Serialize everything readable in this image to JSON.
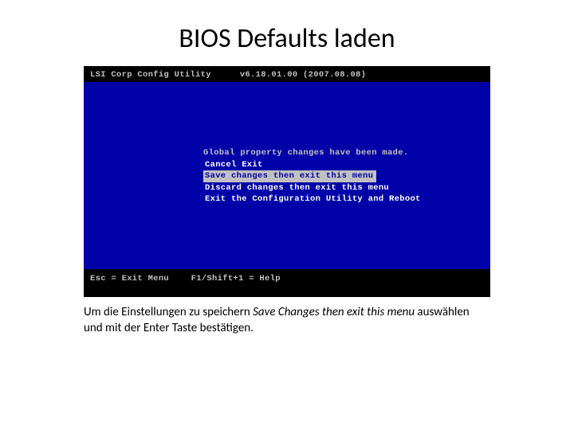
{
  "slide": {
    "title": "BIOS Defaults laden"
  },
  "bios": {
    "headerApp": "LSI Corp Config Utility",
    "headerVersion": "v6.18.01.00 (2007.08.08)",
    "prompt": "Global property changes have been made.",
    "menu": {
      "item0": "Cancel Exit",
      "item1": "Save changes then exit this menu",
      "item2": "Discard changes then exit this menu",
      "item3": "Exit the Configuration Utility and Reboot"
    },
    "footer": {
      "esc": "Esc = Exit Menu",
      "help": "F1/Shift+1 = Help"
    }
  },
  "caption": {
    "pre": "Um die Einstellungen zu speichern ",
    "italic": "Save Changes then exit this menu",
    "post": " auswählen und mit der Enter Taste bestätigen."
  }
}
